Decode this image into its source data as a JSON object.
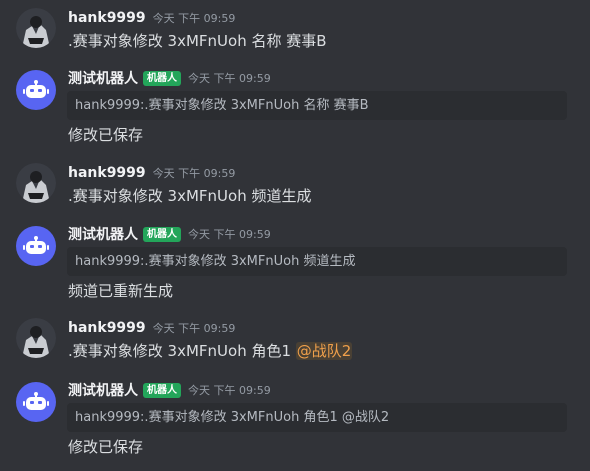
{
  "messages": [
    {
      "type": "user",
      "author": "hank9999",
      "time": "今天 下午 09:59",
      "content": ".赛事对象修改 3xMFnUoh 名称 赛事B"
    },
    {
      "type": "bot",
      "author": "测试机器人",
      "badge": "机器人",
      "time": "今天 下午 09:59",
      "reply": "hank9999:.赛事对象修改 3xMFnUoh 名称 赛事B",
      "content": "修改已保存"
    },
    {
      "type": "user",
      "author": "hank9999",
      "time": "今天 下午 09:59",
      "content": ".赛事对象修改 3xMFnUoh 频道生成"
    },
    {
      "type": "bot",
      "author": "测试机器人",
      "badge": "机器人",
      "time": "今天 下午 09:59",
      "reply": "hank9999:.赛事对象修改 3xMFnUoh 频道生成",
      "content": "频道已重新生成"
    },
    {
      "type": "user",
      "author": "hank9999",
      "time": "今天 下午 09:59",
      "content": ".赛事对象修改 3xMFnUoh 角色1",
      "mention": "@战队2"
    },
    {
      "type": "bot",
      "author": "测试机器人",
      "badge": "机器人",
      "time": "今天 下午 09:59",
      "reply": "hank9999:.赛事对象修改 3xMFnUoh 角色1 @战队2",
      "content": "修改已保存"
    }
  ]
}
